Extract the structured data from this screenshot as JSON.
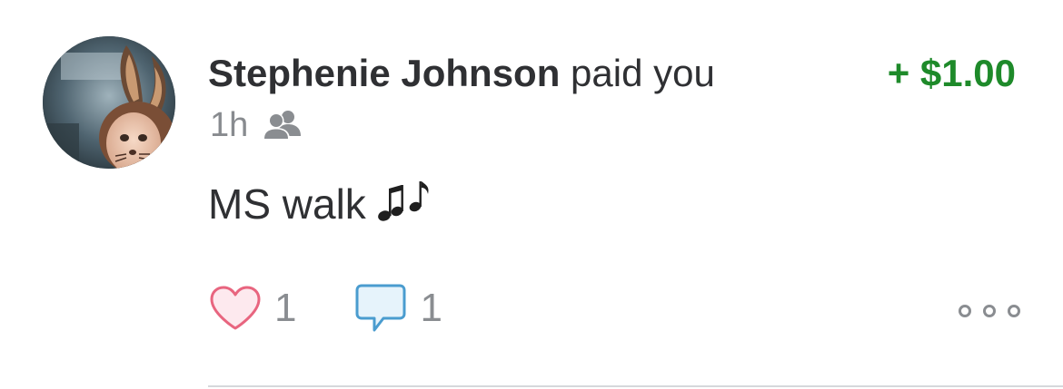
{
  "story": {
    "actor_name": "Stephenie Johnson",
    "verb_text": " paid you",
    "amount": "+ $1.00",
    "time_ago": "1h",
    "audience_icon": "friends-icon",
    "note_text": "MS walk",
    "note_emoji": "music-notes-icon",
    "like_count": "1",
    "comment_count": "1",
    "more_icon": "more-dots-icon"
  },
  "colors": {
    "amount_positive": "#1e8a2a",
    "text_primary": "#2f3033",
    "text_secondary": "#888b8f",
    "like_stroke": "#e8657f",
    "like_fill": "#fde9ee",
    "comment_stroke": "#4a9ccf",
    "comment_fill": "#e6f3fb"
  }
}
